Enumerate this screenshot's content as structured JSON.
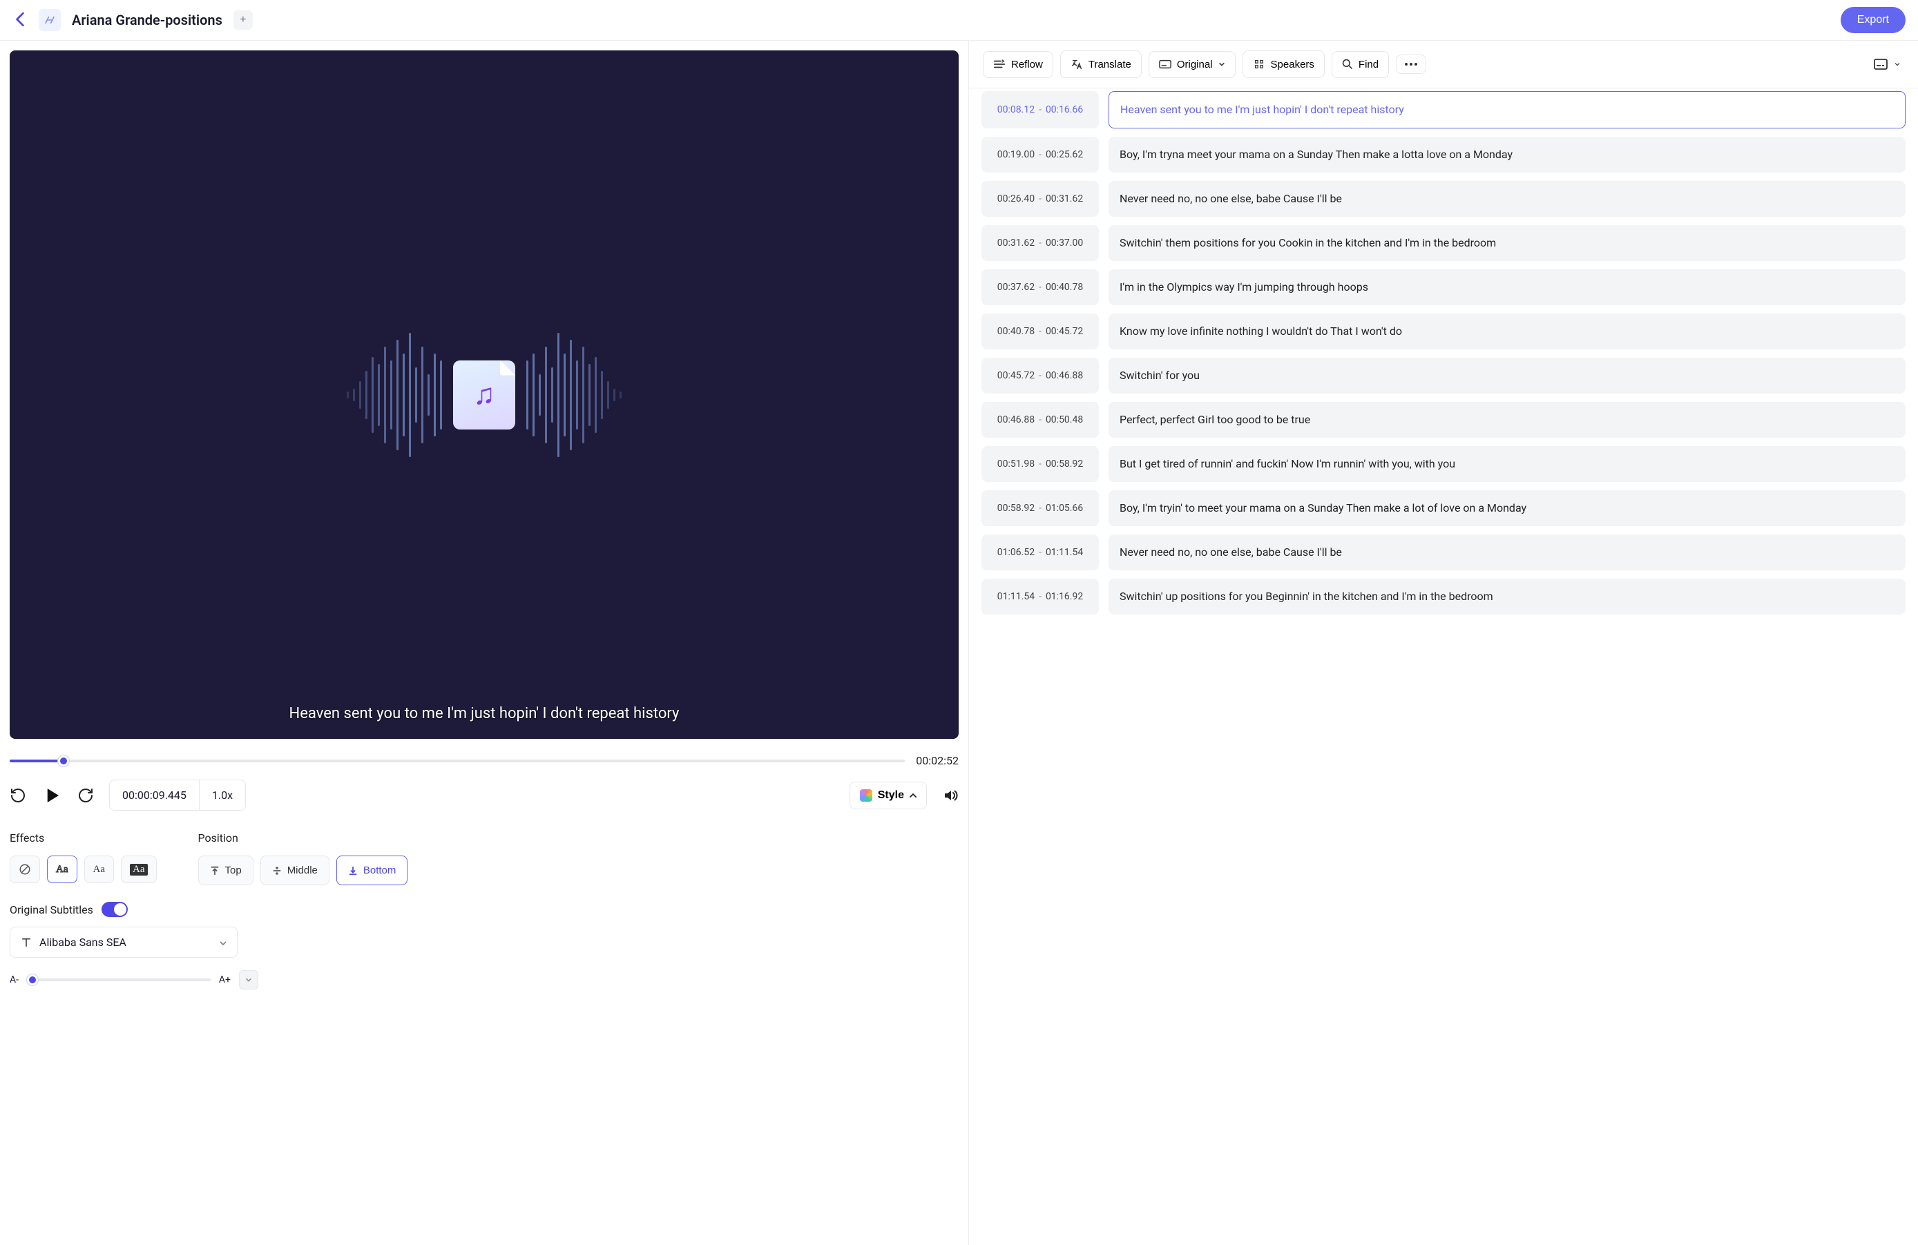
{
  "header": {
    "title": "Ariana Grande-positions",
    "export_label": "Export"
  },
  "preview": {
    "overlay_subtitle": "Heaven sent you to me I'm just hopin' I don't repeat history"
  },
  "transport": {
    "progress_percent": 6,
    "duration": "00:02:52",
    "current_timecode": "00:00:09.445",
    "speed": "1.0x"
  },
  "style_button": "Style",
  "effects": {
    "label": "Effects"
  },
  "position": {
    "label": "Position",
    "top": "Top",
    "middle": "Middle",
    "bottom": "Bottom"
  },
  "original_subtitles": {
    "label": "Original Subtitles",
    "enabled": true
  },
  "font": {
    "name": "Alibaba Sans SEA",
    "size_minus": "A-",
    "size_plus": "A+"
  },
  "toolbar": {
    "reflow": "Reflow",
    "translate": "Translate",
    "original": "Original",
    "speakers": "Speakers",
    "find": "Find"
  },
  "captions": [
    {
      "start": "00:08.12",
      "end": "00:16.66",
      "text": "Heaven sent you to me I'm just hopin' I don't repeat history",
      "active": true
    },
    {
      "start": "00:19.00",
      "end": "00:25.62",
      "text": "Boy, I'm tryna meet your mama on a Sunday Then make a lotta love on a Monday"
    },
    {
      "start": "00:26.40",
      "end": "00:31.62",
      "text": "Never need no, no one else, babe Cause I'll be"
    },
    {
      "start": "00:31.62",
      "end": "00:37.00",
      "text": "Switchin' them positions for you Cookin in the kitchen and I'm in the bedroom"
    },
    {
      "start": "00:37.62",
      "end": "00:40.78",
      "text": "I'm in the Olympics way I'm jumping  through hoops"
    },
    {
      "start": "00:40.78",
      "end": "00:45.72",
      "text": "Know my love infinite nothing I wouldn't do That I won't do"
    },
    {
      "start": "00:45.72",
      "end": "00:46.88",
      "text": "Switchin' for you"
    },
    {
      "start": "00:46.88",
      "end": "00:50.48",
      "text": "Perfect, perfect Girl too good to be true"
    },
    {
      "start": "00:51.98",
      "end": "00:58.92",
      "text": "But I get tired of runnin' and fuckin' Now I'm runnin' with you, with you"
    },
    {
      "start": "00:58.92",
      "end": "01:05.66",
      "text": "Boy, I'm tryin' to meet your mama on a Sunday Then make a lot of love on a Monday"
    },
    {
      "start": "01:06.52",
      "end": "01:11.54",
      "text": "Never need no, no one else, babe Cause I'll be"
    },
    {
      "start": "01:11.54",
      "end": "01:16.92",
      "text": "Switchin' up positions for you Beginnin' in the kitchen and I'm in the bedroom"
    }
  ]
}
